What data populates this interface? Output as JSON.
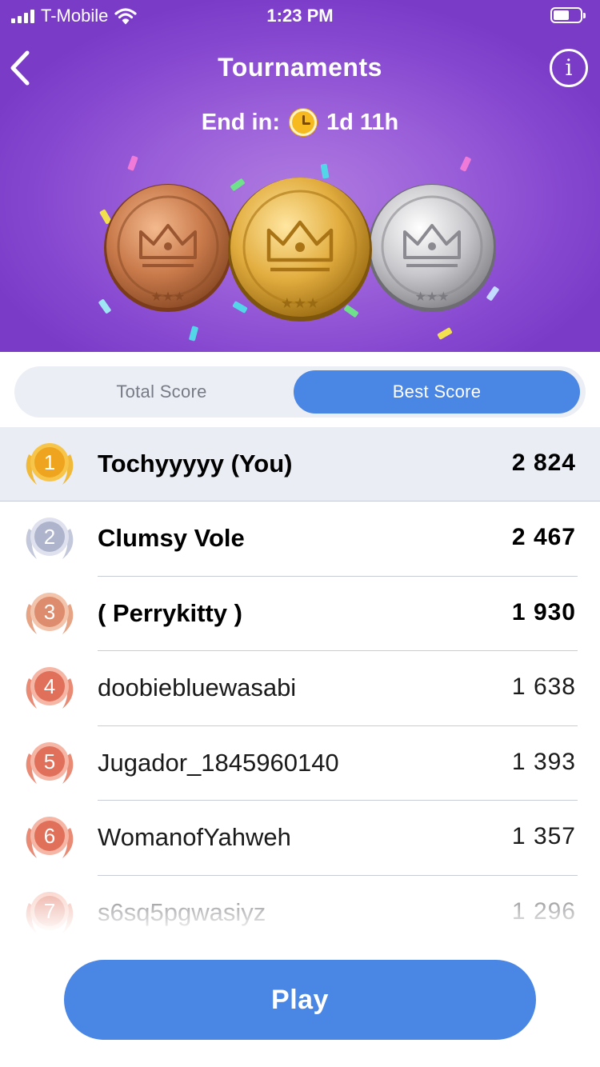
{
  "status_bar": {
    "carrier": "T-Mobile",
    "time": "1:23 PM",
    "wifi_icon": "wifi-icon",
    "battery_icon": "battery-icon"
  },
  "header": {
    "title": "Tournaments",
    "back_icon": "chevron-left-icon",
    "info_icon": "info-icon",
    "timer_label": "End in:",
    "timer_value": "1d 11h",
    "timer_icon": "clock-icon",
    "medals": [
      "bronze-medal",
      "gold-medal",
      "silver-medal"
    ]
  },
  "tabs": {
    "total_score": "Total Score",
    "best_score": "Best Score",
    "selected": "best_score"
  },
  "leaderboard": [
    {
      "rank": "1",
      "name": "Tochyyyyy (You)",
      "score": "2 824",
      "is_me": true,
      "bold": true,
      "badge": "gold"
    },
    {
      "rank": "2",
      "name": "Clumsy Vole",
      "score": "2 467",
      "bold": true,
      "badge": "silver"
    },
    {
      "rank": "3",
      "name": "( Perrykitty )",
      "score": "1 930",
      "bold": true,
      "badge": "bronze"
    },
    {
      "rank": "4",
      "name": "doobiebluewasabi",
      "score": "1 638",
      "badge": "red"
    },
    {
      "rank": "5",
      "name": "Jugador_1845960140",
      "score": "1 393",
      "badge": "red"
    },
    {
      "rank": "6",
      "name": "WomanofYahweh",
      "score": "1 357",
      "badge": "red"
    },
    {
      "rank": "7",
      "name": "s6sq5pgwasiyz",
      "score": "1 296",
      "badge": "red"
    }
  ],
  "badge_colors": {
    "gold": "#eea41e",
    "silver": "#aeb4cc",
    "bronze": "#dd8d6d",
    "red": "#e0705a"
  },
  "play_button": "Play",
  "colors": {
    "header_purple": "#8a4cd2",
    "accent_blue": "#4a86e4",
    "highlight_row": "#eaedf4"
  }
}
